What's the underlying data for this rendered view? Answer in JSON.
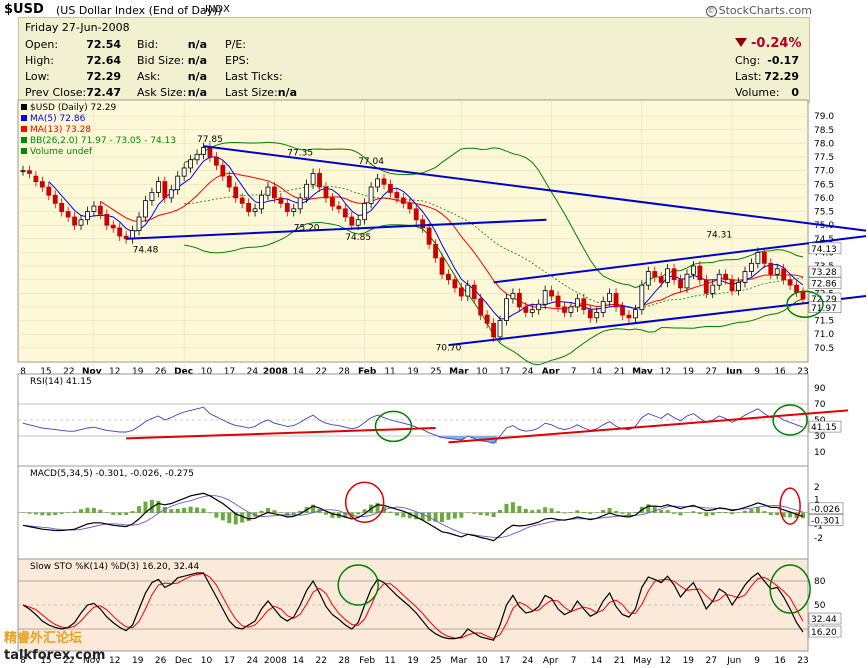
{
  "header": {
    "symbol": "$USD",
    "name": "(US Dollar Index (End of Day))",
    "exchange": "INDX",
    "brand": "StockCharts.com",
    "copyright_symbol": "©"
  },
  "quote": {
    "date": "Friday  27-Jun-2008",
    "open_label": "Open:",
    "open": "72.54",
    "high_label": "High:",
    "high": "72.64",
    "low_label": "Low:",
    "low": "72.29",
    "prev_label": "Prev Close:",
    "prev": "72.47",
    "bid_label": "Bid:",
    "bid": "n/a",
    "bidsize_label": "Bid Size:",
    "bidsize": "n/a",
    "ask_label": "Ask:",
    "ask": "n/a",
    "asksize_label": "Ask Size:",
    "asksize": "n/a",
    "pe_label": "P/E:",
    "eps_label": "EPS:",
    "lastticks_label": "Last Ticks:",
    "lastsize_label": "Last Size:",
    "lastsize": "n/a",
    "pct": "-0.24%",
    "chg_label": "Chg:",
    "chg": "-0.17",
    "last_label": "Last:",
    "last": "72.29",
    "vol_label": "Volume:",
    "vol": "0",
    "change_color": "#8b0000"
  },
  "watermark": {
    "cn": "精睿外汇论坛",
    "site": "talkforex.com"
  },
  "chart_data": [
    {
      "type": "candlestick",
      "legend": [
        "$USD (Daily) 72.29",
        "MA(5) 72.86",
        "MA(13) 73.28",
        "BB(26,2.0) 71.97 - 73.05 - 74.13",
        "Volume undef"
      ],
      "ylim": [
        70.2,
        79.3
      ],
      "y_ticks": [
        "79.0",
        "78.5",
        "78.0",
        "77.5",
        "77.0",
        "76.5",
        "76.0",
        "75.5",
        "75.0",
        "74.5",
        "74.0",
        "73.5",
        "73.0",
        "72.5",
        "72.0",
        "71.5",
        "71.0",
        "70.5"
      ],
      "right_labels": [
        "74.13",
        "73.28",
        "72.86",
        "72.29",
        "71.97"
      ],
      "annotations": [
        {
          "text": "77.85",
          "x_index": 29,
          "value": 78.05
        },
        {
          "text": "77.35",
          "x_index": 43,
          "value": 77.55
        },
        {
          "text": "77.04",
          "x_index": 54,
          "value": 77.25
        },
        {
          "text": "75.20",
          "x_index": 44,
          "value": 74.8
        },
        {
          "text": "74.85",
          "x_index": 52,
          "value": 74.45
        },
        {
          "text": "74.48",
          "x_index": 19,
          "value": 74.0
        },
        {
          "text": "70.70",
          "x_index": 66,
          "value": 70.4
        },
        {
          "text": "74.31",
          "x_index": 108,
          "value": 74.55
        }
      ],
      "x_labels": [
        "8",
        "15",
        "22",
        "Nov",
        "12",
        "19",
        "26",
        "Dec",
        "10",
        "17",
        "24",
        "2008",
        "14",
        "22",
        "28",
        "Feb",
        "11",
        "19",
        "25",
        "Mar",
        "10",
        "17",
        "24",
        "Apr",
        "7",
        "14",
        "21",
        "May",
        "12",
        "19",
        "27",
        "Jun",
        "9",
        "16",
        "23"
      ],
      "colors": {
        "up": "#000000",
        "down": "#cc0000",
        "ma5": "#0000ff",
        "ma13": "#ff0000",
        "bb": "#008000",
        "trend": "#0000cc"
      },
      "close": [
        77.0,
        76.9,
        76.6,
        76.4,
        76.1,
        75.8,
        75.5,
        75.3,
        75.0,
        75.2,
        75.5,
        75.7,
        75.4,
        75.0,
        74.9,
        74.6,
        74.5,
        74.8,
        75.3,
        75.9,
        76.2,
        76.6,
        76.0,
        76.3,
        76.8,
        77.1,
        77.4,
        77.6,
        77.85,
        77.5,
        77.2,
        76.8,
        76.4,
        76.0,
        75.8,
        75.5,
        75.6,
        76.1,
        76.4,
        76.0,
        75.8,
        75.5,
        75.6,
        76.0,
        76.5,
        76.9,
        76.4,
        76.0,
        75.7,
        75.6,
        75.3,
        75.0,
        75.2,
        75.8,
        76.4,
        76.7,
        76.5,
        76.2,
        76.0,
        75.8,
        75.6,
        75.2,
        74.9,
        74.3,
        73.8,
        73.2,
        73.0,
        72.7,
        72.4,
        72.8,
        72.3,
        71.7,
        71.4,
        70.9,
        71.5,
        72.3,
        72.5,
        72.0,
        71.8,
        71.9,
        72.1,
        72.6,
        72.4,
        72.0,
        71.8,
        72.0,
        72.3,
        71.9,
        71.6,
        71.8,
        72.2,
        72.5,
        72.0,
        71.7,
        71.6,
        71.9,
        72.8,
        73.3,
        73.1,
        72.9,
        73.4,
        73.0,
        72.7,
        73.2,
        73.5,
        73.0,
        72.5,
        72.8,
        73.2,
        73.0,
        72.6,
        72.9,
        73.3,
        73.6,
        74.0,
        73.6,
        73.2,
        73.4,
        73.0,
        72.8,
        72.54,
        72.29
      ],
      "open": [
        77.0,
        77.0,
        76.8,
        76.6,
        76.4,
        76.1,
        75.8,
        75.5,
        75.3,
        75.0,
        75.2,
        75.5,
        75.7,
        75.4,
        75.0,
        74.9,
        74.6,
        74.5,
        74.8,
        75.3,
        75.9,
        76.2,
        76.6,
        76.0,
        76.3,
        76.8,
        77.1,
        77.4,
        77.6,
        77.85,
        77.5,
        77.2,
        76.8,
        76.4,
        76.0,
        75.8,
        75.5,
        75.6,
        76.1,
        76.4,
        76.0,
        75.8,
        75.5,
        75.6,
        76.0,
        76.5,
        76.9,
        76.4,
        76.0,
        75.7,
        75.6,
        75.3,
        75.0,
        75.2,
        75.8,
        76.4,
        76.7,
        76.5,
        76.2,
        76.0,
        75.8,
        75.6,
        75.2,
        74.9,
        74.3,
        73.8,
        73.2,
        73.0,
        72.7,
        72.4,
        72.8,
        72.3,
        71.7,
        71.4,
        70.9,
        71.5,
        72.3,
        72.5,
        72.0,
        71.8,
        71.9,
        72.1,
        72.6,
        72.4,
        72.0,
        71.8,
        72.0,
        72.3,
        71.9,
        71.6,
        71.8,
        72.2,
        72.5,
        72.0,
        71.7,
        71.6,
        71.9,
        72.8,
        73.3,
        73.1,
        72.9,
        73.4,
        73.0,
        72.7,
        73.2,
        73.5,
        73.0,
        72.5,
        72.8,
        73.2,
        73.0,
        72.6,
        72.9,
        73.3,
        73.6,
        74.0,
        73.6,
        73.2,
        73.4,
        73.0,
        72.8,
        72.54
      ],
      "trendlines": [
        {
          "from": [
            28,
            77.9
          ],
          "to": [
            125,
            74.8
          ]
        },
        {
          "from": [
            16,
            74.5
          ],
          "to": [
            75,
            75.2
          ]
        },
        {
          "from": [
            66,
            70.6
          ],
          "to": [
            125,
            72.4
          ]
        },
        {
          "from": [
            73,
            72.9
          ],
          "to": [
            125,
            74.6
          ]
        }
      ]
    },
    {
      "type": "line",
      "name": "RSI(14) 41.15",
      "ylim": [
        0,
        100
      ],
      "y_ticks": [
        "90",
        "70",
        "50",
        "30",
        "10"
      ],
      "right_label": "41.15",
      "values": [
        46,
        44,
        42,
        40,
        39,
        38,
        37,
        36,
        36,
        38,
        40,
        41,
        39,
        37,
        36,
        35,
        35,
        37,
        42,
        48,
        52,
        55,
        50,
        53,
        57,
        60,
        62,
        64,
        66,
        58,
        54,
        50,
        46,
        43,
        42,
        40,
        42,
        47,
        50,
        46,
        44,
        42,
        43,
        47,
        52,
        56,
        50,
        46,
        44,
        43,
        41,
        39,
        41,
        47,
        53,
        56,
        53,
        50,
        48,
        46,
        44,
        41,
        38,
        34,
        31,
        28,
        27,
        26,
        25,
        30,
        27,
        24,
        23,
        21,
        30,
        40,
        43,
        38,
        36,
        37,
        40,
        46,
        44,
        40,
        38,
        40,
        44,
        40,
        37,
        39,
        44,
        48,
        42,
        39,
        38,
        42,
        53,
        58,
        55,
        52,
        58,
        53,
        49,
        55,
        58,
        52,
        47,
        50,
        55,
        52,
        47,
        51,
        56,
        60,
        64,
        58,
        53,
        55,
        50,
        47,
        44,
        41
      ],
      "trendlines": [
        {
          "from": [
            16,
            27
          ],
          "to": [
            64,
            40
          ]
        },
        {
          "from": [
            66,
            22
          ],
          "to": [
            125,
            62
          ]
        }
      ]
    },
    {
      "type": "line",
      "name": "MACD(5,34,5) -0.301, -0.026, -0.275",
      "ylim": [
        -3,
        3
      ],
      "y_ticks": [
        "2",
        "1",
        "0",
        "-1",
        "-2"
      ],
      "right_labels": [
        "-0.026",
        "-0.301"
      ],
      "macd": [
        -1.0,
        -1.1,
        -1.2,
        -1.3,
        -1.35,
        -1.4,
        -1.4,
        -1.35,
        -1.3,
        -1.1,
        -0.9,
        -0.8,
        -0.8,
        -0.9,
        -1.0,
        -1.05,
        -1.1,
        -0.9,
        -0.5,
        0.0,
        0.4,
        0.7,
        0.6,
        0.7,
        0.9,
        1.1,
        1.3,
        1.4,
        1.5,
        1.3,
        1.0,
        0.7,
        0.3,
        -0.1,
        -0.3,
        -0.5,
        -0.45,
        -0.2,
        0.0,
        -0.1,
        -0.2,
        -0.35,
        -0.3,
        -0.1,
        0.2,
        0.5,
        0.35,
        0.1,
        -0.1,
        -0.2,
        -0.35,
        -0.5,
        -0.4,
        -0.1,
        0.3,
        0.6,
        0.55,
        0.4,
        0.25,
        0.1,
        -0.1,
        -0.35,
        -0.6,
        -0.9,
        -1.2,
        -1.5,
        -1.6,
        -1.75,
        -1.9,
        -1.7,
        -1.8,
        -1.95,
        -2.05,
        -2.2,
        -1.8,
        -1.3,
        -1.0,
        -1.05,
        -1.0,
        -0.9,
        -0.75,
        -0.5,
        -0.45,
        -0.55,
        -0.6,
        -0.5,
        -0.35,
        -0.45,
        -0.55,
        -0.45,
        -0.25,
        -0.05,
        -0.2,
        -0.3,
        -0.35,
        -0.2,
        0.2,
        0.5,
        0.5,
        0.45,
        0.6,
        0.45,
        0.3,
        0.45,
        0.55,
        0.35,
        0.15,
        0.2,
        0.35,
        0.3,
        0.15,
        0.25,
        0.4,
        0.55,
        0.75,
        0.6,
        0.4,
        0.4,
        0.2,
        0.05,
        -0.15,
        -0.301
      ],
      "signal_color": "#6a5acd",
      "macd_color": "#000000",
      "hist_color": "#6aaa3a"
    },
    {
      "type": "line",
      "name": "Slow STO %K(14) %D(3) 16.20, 32.44",
      "ylim": [
        0,
        100
      ],
      "y_ticks": [
        "80",
        "50",
        "20"
      ],
      "right_labels": [
        "32.44",
        "16.20"
      ],
      "k": [
        50,
        45,
        38,
        30,
        25,
        22,
        20,
        22,
        28,
        40,
        50,
        52,
        45,
        35,
        28,
        22,
        18,
        25,
        45,
        65,
        78,
        82,
        72,
        76,
        84,
        86,
        88,
        90,
        90,
        75,
        60,
        45,
        30,
        22,
        20,
        25,
        30,
        45,
        55,
        45,
        35,
        30,
        35,
        50,
        68,
        80,
        65,
        48,
        38,
        32,
        25,
        20,
        28,
        50,
        70,
        82,
        78,
        70,
        62,
        55,
        48,
        40,
        30,
        20,
        14,
        10,
        8,
        8,
        10,
        20,
        15,
        10,
        8,
        6,
        25,
        50,
        62,
        48,
        40,
        42,
        48,
        62,
        58,
        45,
        38,
        42,
        55,
        45,
        36,
        40,
        55,
        65,
        48,
        38,
        35,
        45,
        72,
        85,
        82,
        78,
        86,
        75,
        60,
        70,
        78,
        62,
        45,
        55,
        70,
        65,
        50,
        62,
        75,
        84,
        90,
        80,
        70,
        72,
        60,
        45,
        28,
        16.2
      ],
      "d_color": "#ff0000",
      "k_color": "#000000"
    }
  ]
}
